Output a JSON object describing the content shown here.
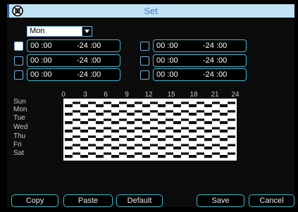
{
  "window": {
    "title": "Set",
    "icon": "wrench-gear-icon",
    "colors": {
      "titlebar_bg": "#c0e2f4",
      "title_text": "#3c7dd0",
      "field_border": "#3fb8c8",
      "background": "#000000"
    }
  },
  "day_select": {
    "value": "Mon"
  },
  "periods": [
    {
      "start": "00 :00",
      "end": "-24 :00",
      "checked": true
    },
    {
      "start": "00 :00",
      "end": "-24 :00",
      "checked": false
    },
    {
      "start": "00 :00",
      "end": "-24 :00",
      "checked": false
    },
    {
      "start": "00 :00",
      "end": "-24 :00",
      "checked": false
    },
    {
      "start": "00 :00",
      "end": "-24 :00",
      "checked": false
    },
    {
      "start": "00 :00",
      "end": "-24 :00",
      "checked": false
    }
  ],
  "schedule": {
    "days": [
      "Sun",
      "Mon",
      "Tue",
      "Wed",
      "Thu",
      "Fri",
      "Sat"
    ],
    "hours": [
      "0",
      "3",
      "6",
      "9",
      "12",
      "15",
      "18",
      "21",
      "24"
    ]
  },
  "buttons": {
    "copy": "Copy",
    "paste": "Paste",
    "default": "Default",
    "save": "Save",
    "cancel": "Cancel"
  }
}
